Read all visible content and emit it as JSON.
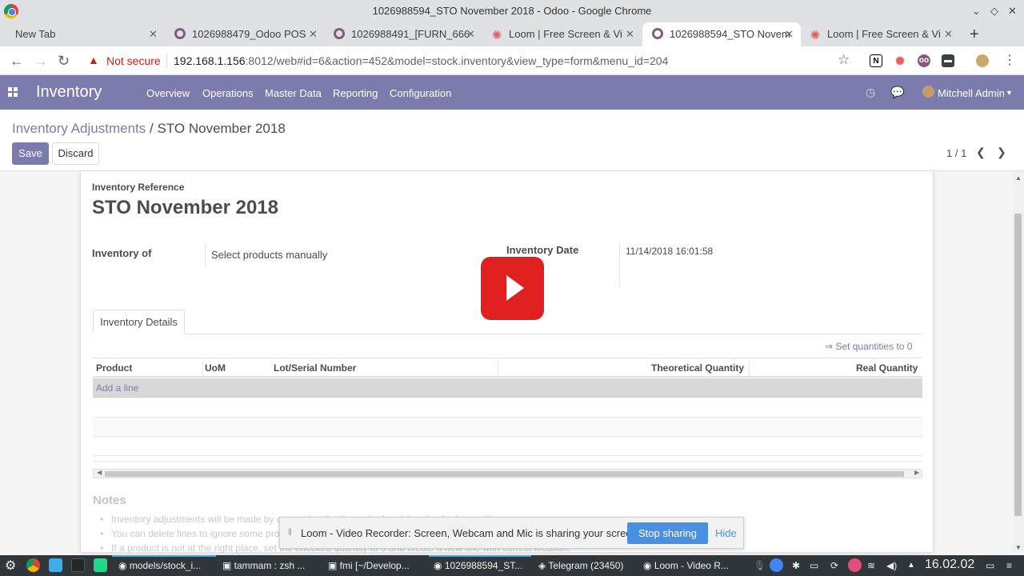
{
  "window": {
    "title": "1026988594_STO November 2018 - Odoo - Google Chrome"
  },
  "tabs": [
    {
      "label": "New Tab"
    },
    {
      "label": "1026988479_Odoo POS"
    },
    {
      "label": "1026988491_[FURN_666"
    },
    {
      "label": "Loom | Free Screen & Vi"
    },
    {
      "label": "1026988594_STO Novem"
    },
    {
      "label": "Loom | Free Screen & Vi"
    }
  ],
  "address": {
    "security": "Not secure",
    "host": "192.168.1.156",
    "path": ":8012/web#id=6&action=452&model=stock.inventory&view_type=form&menu_id=204"
  },
  "odoo_nav": {
    "app": "Inventory",
    "menu": [
      "Overview",
      "Operations",
      "Master Data",
      "Reporting",
      "Configuration"
    ],
    "user": "Mitchell Admin"
  },
  "breadcrumb": {
    "parent": "Inventory Adjustments",
    "separator": "/",
    "current": "STO November 2018"
  },
  "buttons": {
    "save": "Save",
    "discard": "Discard"
  },
  "pager": "1 / 1",
  "form": {
    "ref_label": "Inventory Reference",
    "ref_value": "STO November 2018",
    "inventory_of_label": "Inventory of",
    "inventory_of_value": "Select products manually",
    "date_label": "Inventory Date",
    "date_value": "11/14/2018 16:01:58"
  },
  "notebook": {
    "tab": "Inventory Details",
    "set_quantities": "⇒ Set quantities to 0"
  },
  "table": {
    "columns": [
      "Product",
      "UoM",
      "Lot/Serial Number",
      "Theoretical Quantity",
      "Real Quantity"
    ],
    "add_line": "Add a line"
  },
  "notes": {
    "title": "Notes",
    "items": [
      "Inventory adjustments will be made by comparing the theoretical and the checked quantities.",
      "You can delete lines to ignore some products.",
      "If a product is not at the right place, set the checked quantity to 0 and create a new line with correct location."
    ]
  },
  "loom_banner": {
    "message": "Loom - Video Recorder: Screen, Webcam and Mic is sharing your screen.",
    "stop": "Stop sharing",
    "hide": "Hide"
  },
  "taskbar": {
    "items": [
      "models/stock_i...",
      "tammam : zsh ...",
      "fmi [~/Develop...",
      "1026988594_ST...",
      "Telegram (23450)",
      "Loom - Video R..."
    ],
    "clock": "16.02.02"
  },
  "colors": {
    "odoo_primary": "#7c7bad",
    "loom_stop": "#4a90e2",
    "play_red": "#e02020"
  }
}
